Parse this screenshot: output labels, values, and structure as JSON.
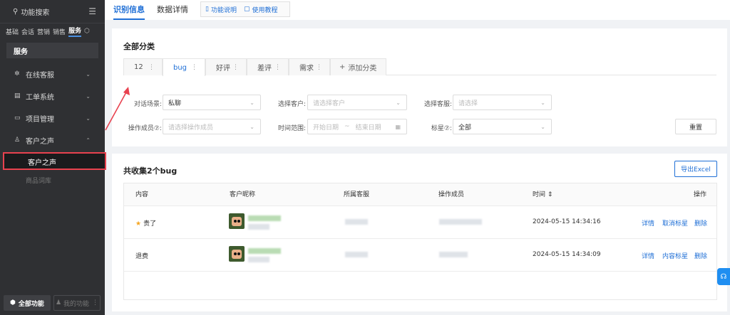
{
  "sidebar": {
    "search_label": "功能搜索",
    "categories": [
      {
        "label": "基础",
        "active": false
      },
      {
        "label": "会话",
        "active": false
      },
      {
        "label": "营销",
        "active": false
      },
      {
        "label": "销售",
        "active": false
      },
      {
        "label": "服务",
        "active": true
      }
    ],
    "section_title": "服务",
    "items": [
      {
        "label": "在线客服",
        "icon": "headset-icon",
        "chevron": "⌄"
      },
      {
        "label": "工单系统",
        "icon": "ticket-icon",
        "chevron": "⌄"
      },
      {
        "label": "项目管理",
        "icon": "project-icon",
        "chevron": "⌄"
      },
      {
        "label": "客户之声",
        "icon": "user-voice-icon",
        "chevron": "⌃"
      }
    ],
    "sub_active": "客户之声",
    "sub_other": "商品词库",
    "all_functions": "全部功能",
    "my_functions": "我的功能"
  },
  "topbar": {
    "tabs": [
      {
        "label": "识别信息",
        "active": true
      },
      {
        "label": "数据详情",
        "active": false
      }
    ],
    "links": [
      "功能说明",
      "使用教程"
    ]
  },
  "filters": {
    "title": "全部分类",
    "cat_tabs": [
      {
        "label": "12",
        "active": false
      },
      {
        "label": "bug",
        "active": true
      },
      {
        "label": "好评",
        "active": false
      },
      {
        "label": "差评",
        "active": false
      },
      {
        "label": "需求",
        "active": false
      }
    ],
    "add_tab": "添加分类",
    "scene_label": "对话场景:",
    "scene_value": "私聊",
    "customer_label": "选择客户:",
    "customer_placeholder": "请选择客户",
    "agent_label": "选择客服:",
    "agent_placeholder": "请选择",
    "member_label": "操作成员⑦:",
    "member_placeholder": "请选择操作成员",
    "time_label": "时间范围:",
    "start_placeholder": "开始日期",
    "range_sep": "~",
    "end_placeholder": "结束日期",
    "star_label": "标星⑦:",
    "star_value": "全部",
    "reset": "重置"
  },
  "table": {
    "title": "共收集2个bug",
    "export": "导出Excel",
    "headers": [
      "内容",
      "客户昵称",
      "所属客服",
      "操作成员",
      "时间 ⇕",
      "操作"
    ],
    "rows": [
      {
        "content": "贵了",
        "starred": true,
        "time": "2024-05-15 14:34:16",
        "actions": [
          "详情",
          "取消标星",
          "删除"
        ]
      },
      {
        "content": "退费",
        "starred": false,
        "time": "2024-05-15 14:34:09",
        "actions": [
          "详情",
          "内容标星",
          "删除"
        ]
      }
    ]
  }
}
